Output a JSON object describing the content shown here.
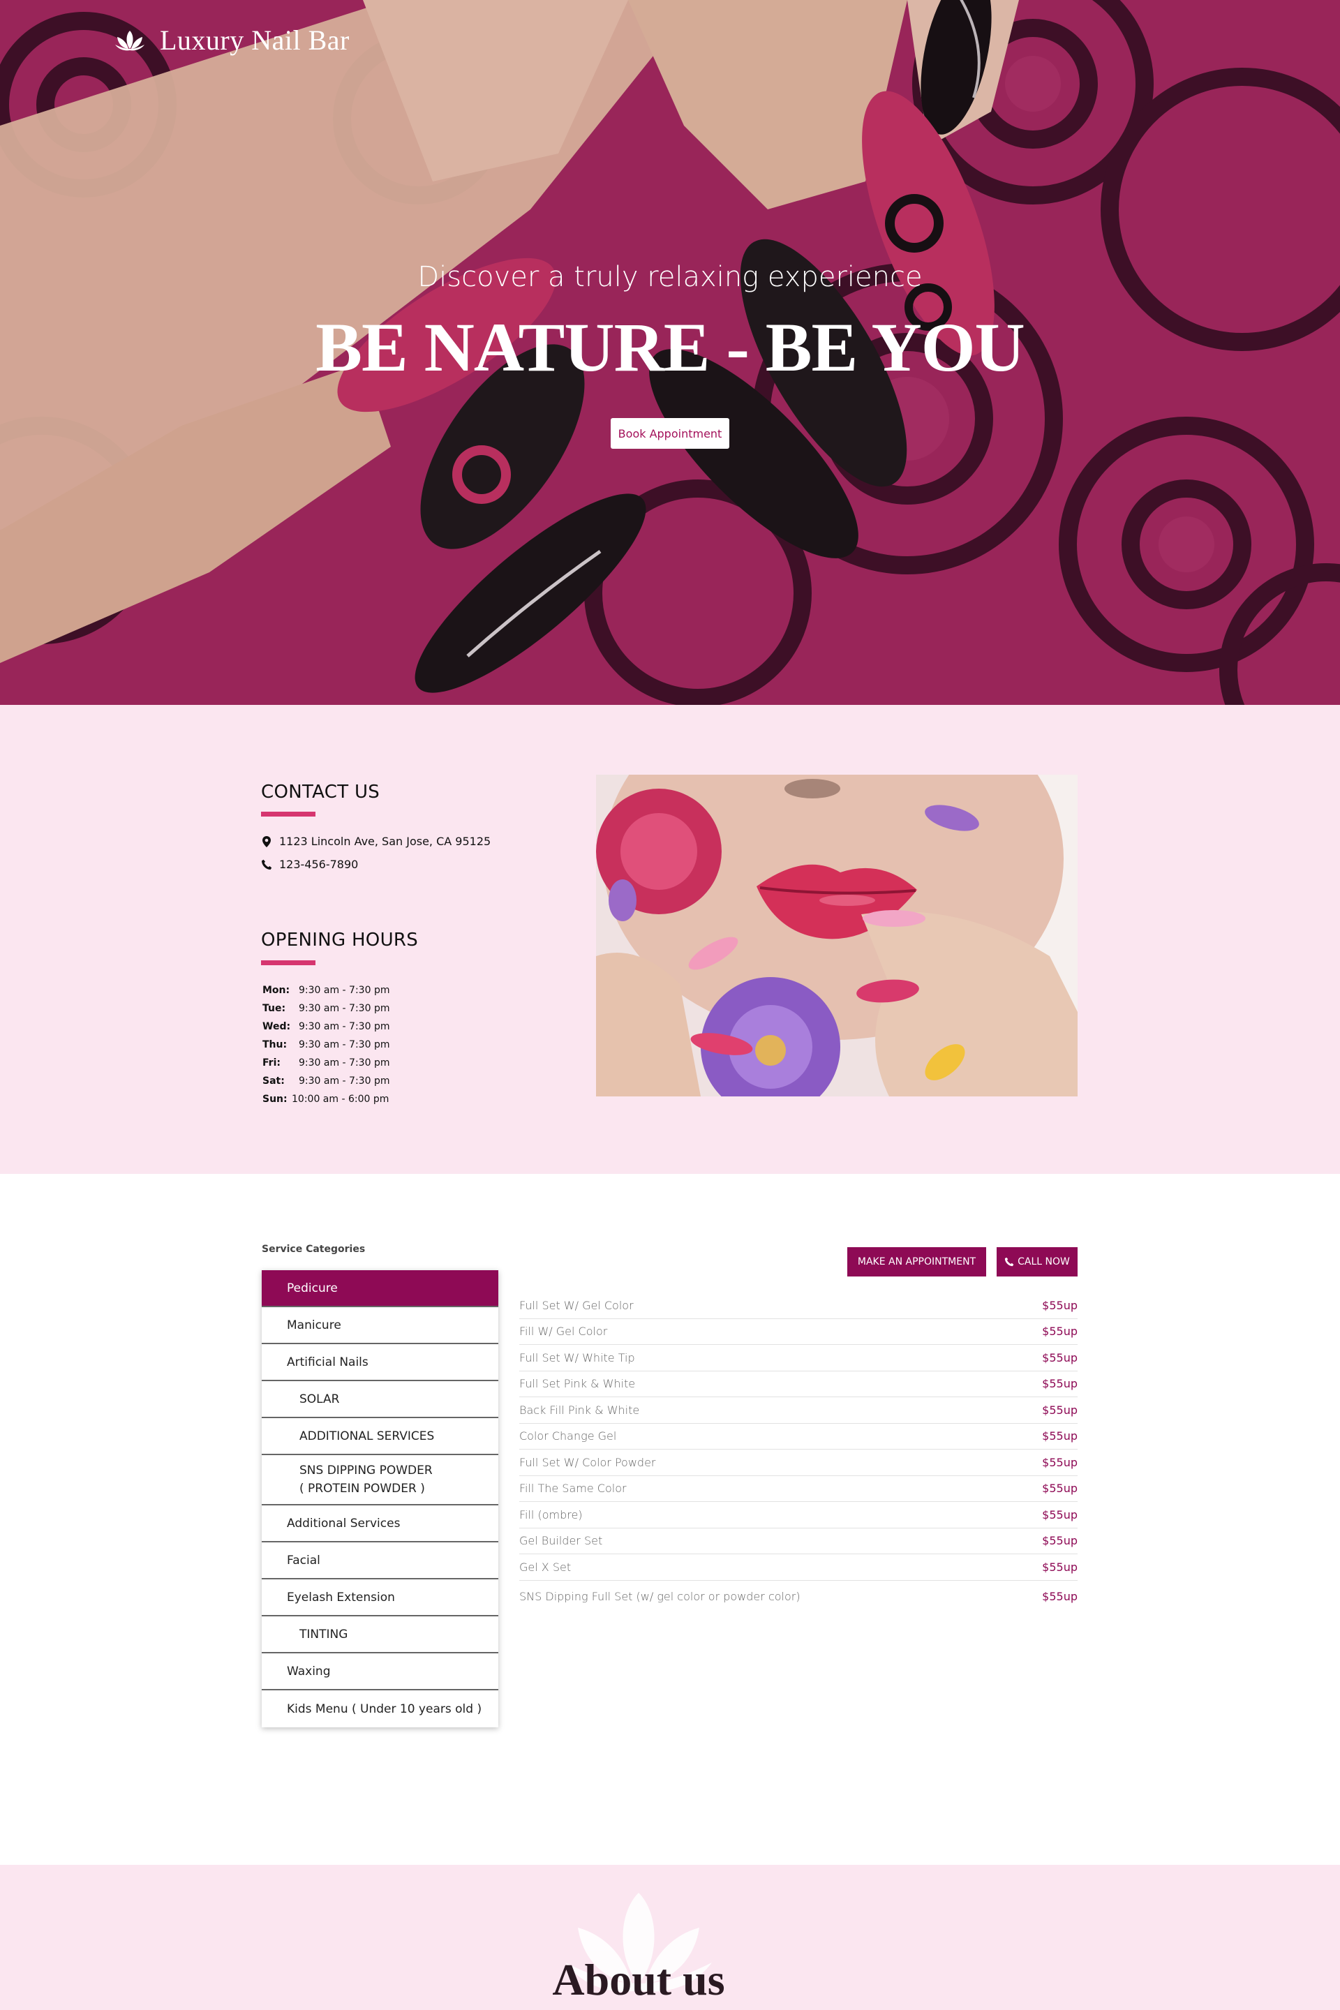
{
  "header": {
    "brand_name": "Luxury Nail Bar",
    "logo_icon": "lotus-icon"
  },
  "hero": {
    "subtitle": "Discover a truly relaxing experience",
    "title": "BE NATURE - BE YOU",
    "cta_label": "Book Appointment"
  },
  "contact": {
    "heading": "CONTACT US",
    "address": "1123 Lincoln Ave, San Jose, CA 95125",
    "phone": "123-456-7890",
    "address_icon": "map-pin-icon",
    "phone_icon": "phone-icon"
  },
  "hours": {
    "heading": "OPENING HOURS",
    "rows": [
      {
        "day": "Mon:",
        "time": "9:30 am - 7:30 pm"
      },
      {
        "day": "Tue:",
        "time": "9:30 am - 7:30 pm"
      },
      {
        "day": "Wed:",
        "time": "9:30 am - 7:30 pm"
      },
      {
        "day": "Thu:",
        "time": "9:30 am - 7:30 pm"
      },
      {
        "day": "Fri:",
        "time": "9:30 am - 7:30 pm"
      },
      {
        "day": "Sat:",
        "time": "9:30 am - 7:30 pm"
      },
      {
        "day": "Sun:",
        "time": "10:00 am - 6:00 pm"
      }
    ]
  },
  "services": {
    "categories_title": "Service Categories",
    "categories": [
      {
        "label": "Pedicure",
        "active": true,
        "sub": false
      },
      {
        "label": "Manicure",
        "active": false,
        "sub": false
      },
      {
        "label": "Artificial Nails",
        "active": false,
        "sub": false
      },
      {
        "label": "SOLAR",
        "active": false,
        "sub": true
      },
      {
        "label": "ADDITIONAL SERVICES",
        "active": false,
        "sub": true
      },
      {
        "label": "SNS DIPPING POWDER",
        "label2": "( PROTEIN POWDER )",
        "active": false,
        "sub": true
      },
      {
        "label": "Additional Services",
        "active": false,
        "sub": false
      },
      {
        "label": "Facial",
        "active": false,
        "sub": false
      },
      {
        "label": "Eyelash Extension",
        "active": false,
        "sub": false
      },
      {
        "label": "TINTING",
        "active": false,
        "sub": true
      },
      {
        "label": "Waxing",
        "active": false,
        "sub": false
      },
      {
        "label": "Kids Menu ( Under 10 years old )",
        "active": false,
        "sub": false
      }
    ],
    "appointment_label": "MAKE AN APPOINTMENT",
    "call_label": "CALL NOW",
    "call_icon": "phone-icon",
    "items": [
      {
        "name": "Full Set W/ Gel Color",
        "price": "$55up"
      },
      {
        "name": "Fill W/ Gel Color",
        "price": "$55up"
      },
      {
        "name": "Full Set W/ White Tip",
        "price": "$55up"
      },
      {
        "name": "Full Set Pink & White",
        "price": "$55up"
      },
      {
        "name": "Back Fill Pink & White",
        "price": "$55up"
      },
      {
        "name": "Color Change Gel",
        "price": "$55up"
      },
      {
        "name": "Full Set W/ Color Powder",
        "price": "$55up"
      },
      {
        "name": "Fill The Same Color",
        "price": "$55up"
      },
      {
        "name": "Fill (ombre)",
        "price": "$55up"
      },
      {
        "name": "Gel Builder Set",
        "price": "$55up"
      },
      {
        "name": "Gel X Set",
        "price": "$55up"
      },
      {
        "name": "SNS Dipping Full Set (w/ gel color or powder color)",
        "price": "$55up"
      }
    ]
  },
  "about": {
    "title": "About us",
    "decor_icon": "lotus-icon"
  },
  "colors": {
    "accent": "#8e0a55",
    "accent_rule": "#d6356f",
    "hero_bg": "#a3285f",
    "section_bg": "#fbe6f0"
  }
}
